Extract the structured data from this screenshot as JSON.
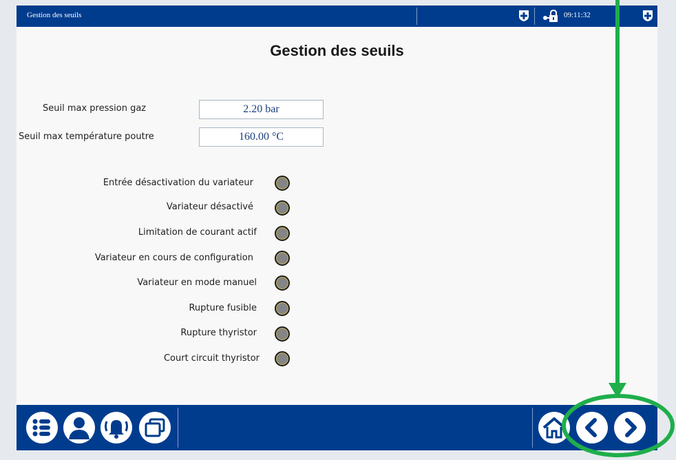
{
  "topbar": {
    "title": "Gestion des seuils",
    "time": "09:11:32"
  },
  "page_title": "Gestion des seuils",
  "fields": [
    {
      "label": "Seuil max pression gaz",
      "value": "2.20 bar"
    },
    {
      "label": "Seuil max température poutre",
      "value": "160.00 °C"
    }
  ],
  "status_items": [
    {
      "label": "Entrée désactivation du variateur"
    },
    {
      "label": "Variateur désactivé"
    },
    {
      "label": "Limitation de courant actif"
    },
    {
      "label": "Variateur en cours de configuration"
    },
    {
      "label": "Variateur en mode manuel"
    },
    {
      "label": "Rupture fusible"
    },
    {
      "label": "Rupture thyristor"
    },
    {
      "label": "Court circuit thyristor"
    }
  ],
  "colors": {
    "bar": "#003c8e",
    "indicator_off": "#858585",
    "annotation": "#1fae4b"
  },
  "bottom_icons": [
    "menu-list-icon",
    "user-icon",
    "alarm-bell-icon",
    "windows-icon",
    "home-icon",
    "back-arrow-icon",
    "forward-arrow-icon"
  ]
}
